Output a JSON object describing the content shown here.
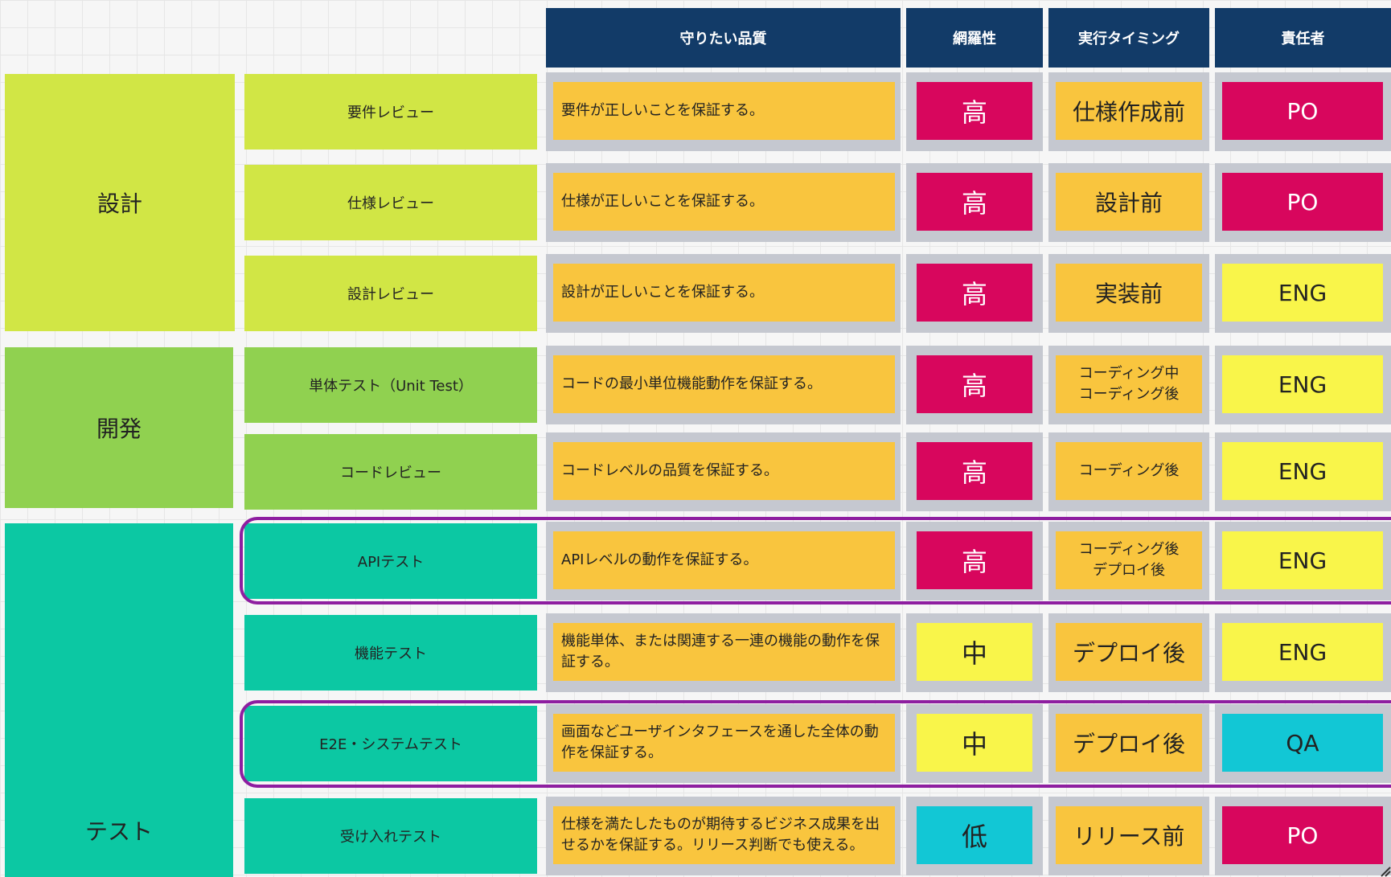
{
  "colors": {
    "header": "#123b68",
    "design": "#d1e645",
    "dev": "#90d150",
    "test": "#0cc8a3",
    "note": "#f9c53e",
    "high": "#d8065d",
    "medium": "#f9f54a",
    "low": "#12c7d5",
    "highlight": "#8e1ea0"
  },
  "header": {
    "quality": "守りたい品質",
    "coverage": "網羅性",
    "timing": "実行タイミング",
    "owner": "責任者"
  },
  "phases": {
    "design": "設計",
    "dev": "開発",
    "test": "テスト"
  },
  "rows": [
    {
      "activity": "要件レビュー",
      "quality": "要件が正しいことを保証する。",
      "coverage": "高",
      "timing": "仕様作成前",
      "owner": "PO"
    },
    {
      "activity": "仕様レビュー",
      "quality": "仕様が正しいことを保証する。",
      "coverage": "高",
      "timing": "設計前",
      "owner": "PO"
    },
    {
      "activity": "設計レビュー",
      "quality": "設計が正しいことを保証する。",
      "coverage": "高",
      "timing": "実装前",
      "owner": "ENG"
    },
    {
      "activity": "単体テスト（Unit Test）",
      "quality": "コードの最小単位機能動作を保証する。",
      "coverage": "高",
      "timing": "コーディング中\nコーディング後",
      "owner": "ENG"
    },
    {
      "activity": "コードレビュー",
      "quality": "コードレベルの品質を保証する。",
      "coverage": "高",
      "timing": "コーディング後",
      "owner": "ENG"
    },
    {
      "activity": "APIテスト",
      "quality": "APIレベルの動作を保証する。",
      "coverage": "高",
      "timing": "コーディング後\nデプロイ後",
      "owner": "ENG"
    },
    {
      "activity": "機能テスト",
      "quality": "機能単体、または関連する一連の機能の動作を保証する。",
      "coverage": "中",
      "timing": "デプロイ後",
      "owner": "ENG"
    },
    {
      "activity": "E2E・システムテスト",
      "quality": "画面などユーザインタフェースを通した全体の動作を保証する。",
      "coverage": "中",
      "timing": "デプロイ後",
      "owner": "QA"
    },
    {
      "activity": "受け入れテスト",
      "quality": "仕様を満たしたものが期待するビジネス成果を出せるかを保証する。リリース判断でも使える。",
      "coverage": "低",
      "timing": "リリース前",
      "owner": "PO"
    }
  ]
}
